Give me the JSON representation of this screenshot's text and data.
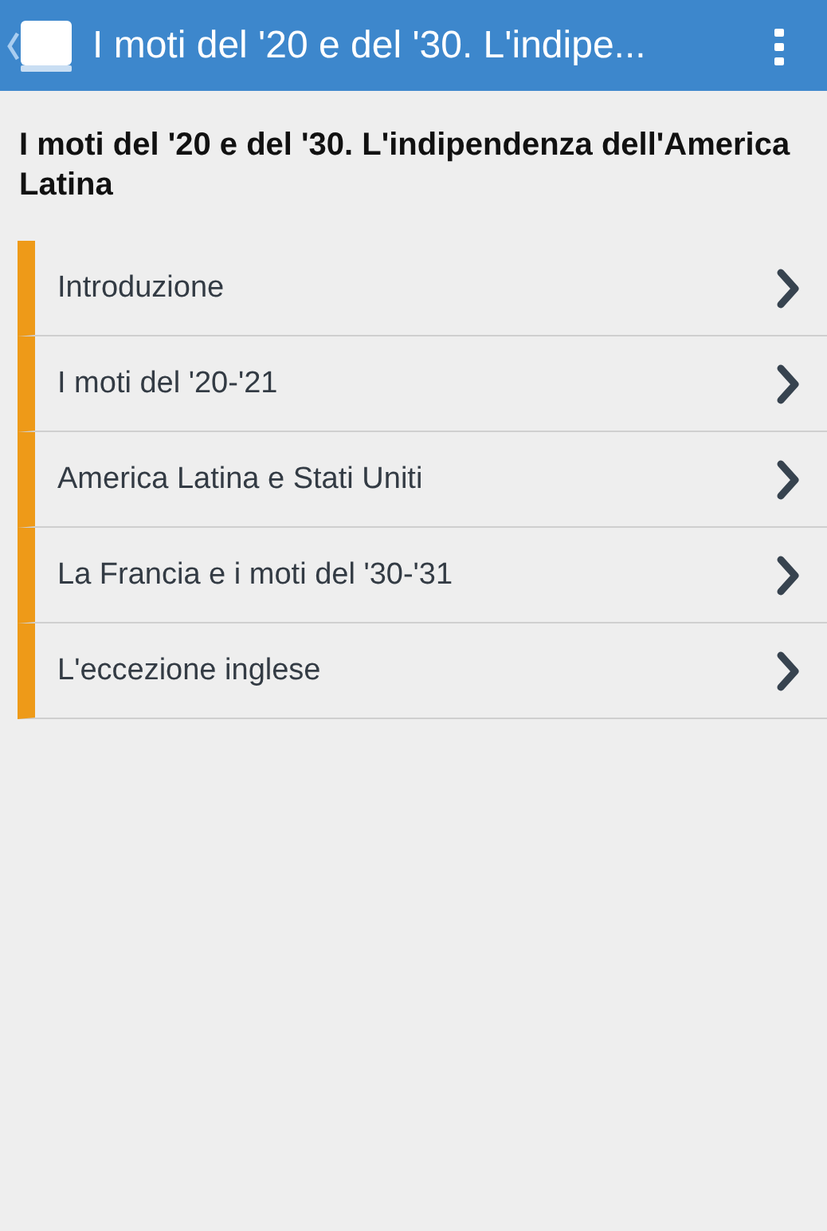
{
  "app_bar": {
    "title": "I moti del '20 e del '30. L'indipe..."
  },
  "heading": "I moti del '20 e del '30. L'indipendenza dell'America Latina",
  "sections": [
    {
      "label": "Introduzione"
    },
    {
      "label": "I moti del '20-'21"
    },
    {
      "label": "America Latina e Stati Uniti"
    },
    {
      "label": "La Francia e i moti del '30-'31"
    },
    {
      "label": "L'eccezione inglese"
    }
  ]
}
